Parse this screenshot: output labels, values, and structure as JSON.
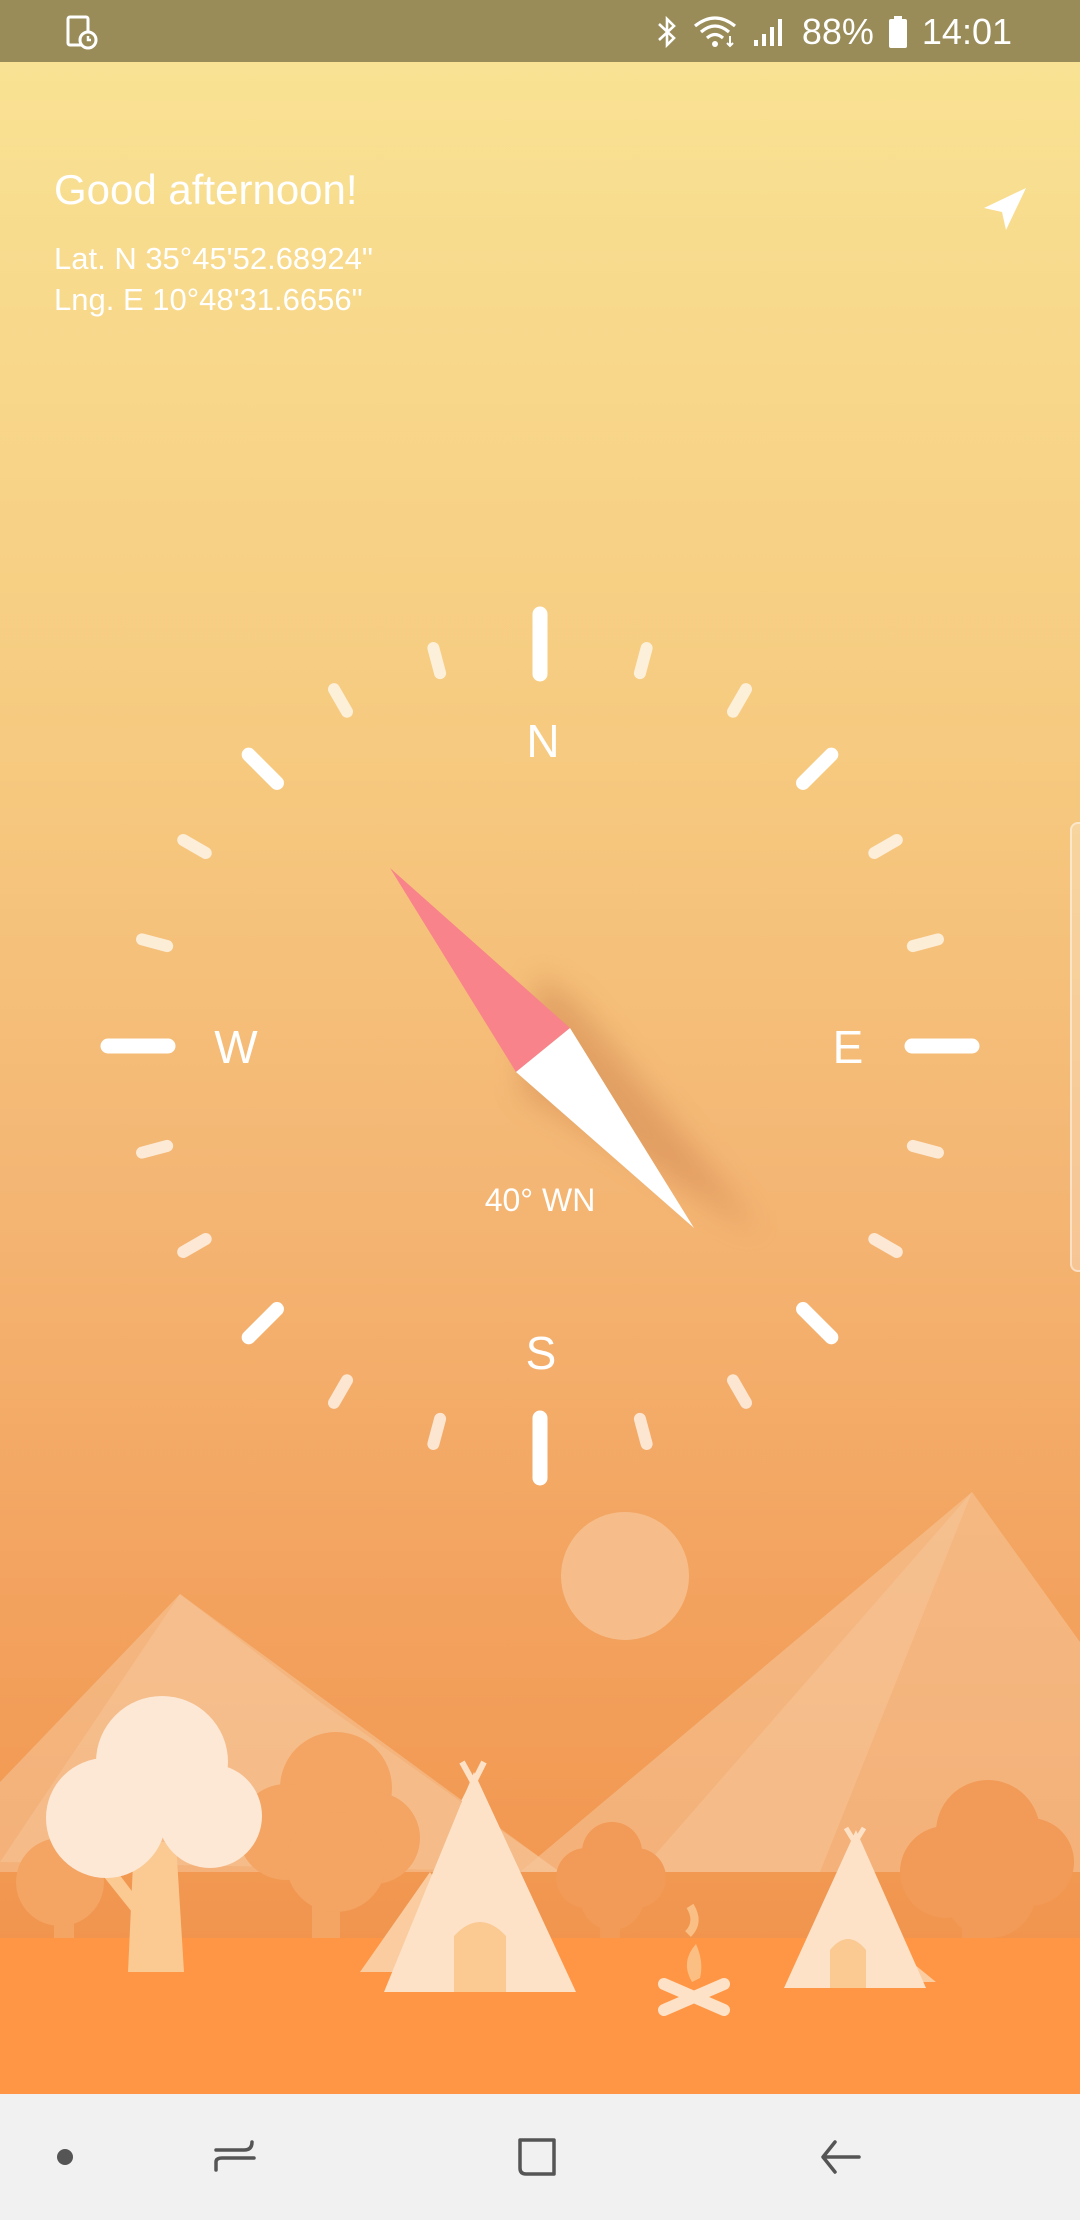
{
  "status_bar": {
    "battery": "88%",
    "time": "14:01",
    "icons": [
      "screenshot-icon",
      "bluetooth-icon",
      "wifi-icon",
      "signal-icon",
      "battery-icon"
    ]
  },
  "header": {
    "greeting": "Good afternoon!",
    "latitude": "Lat.  N 35°45'52.68924\"",
    "longitude": "Lng. E 10°48'31.6656\""
  },
  "compass": {
    "north": "N",
    "east": "E",
    "south": "S",
    "west": "W",
    "heading_text": "40° WN",
    "heading_degrees": 320
  },
  "colors": {
    "needle_north": "#f8838a",
    "needle_south": "#ffffff",
    "status_bar": "#998c58",
    "ground": "#ff9645"
  },
  "nav_bar": {
    "buttons": [
      "dot-icon",
      "recents-icon",
      "home-icon",
      "back-icon"
    ]
  }
}
